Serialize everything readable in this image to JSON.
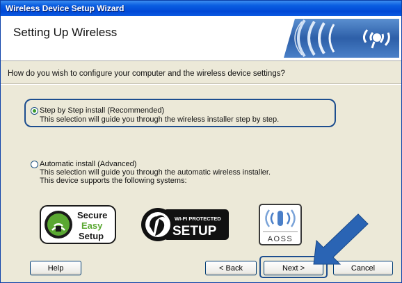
{
  "window": {
    "title": "Wireless Device Setup Wizard"
  },
  "header": {
    "title": "Setting Up Wireless",
    "banner_icon": "wireless-signal-icon"
  },
  "question": "How do you wish to configure your computer and the wireless device settings?",
  "options": [
    {
      "label": "Step by Step install (Recommended)",
      "description": "This selection will guide you through the wireless installer step by step.",
      "selected": true
    },
    {
      "label": "Automatic install (Advanced)",
      "description_lines": [
        "This selection will guide you through the automatic wireless installer.",
        "This device supports the following systems:"
      ],
      "selected": false
    }
  ],
  "logos": {
    "secure_easy_setup": {
      "line1": "Secure",
      "line2": "Easy",
      "line3": "Setup"
    },
    "wifi_protected_setup": {
      "top": "WI-FI PROTECTED",
      "bottom": "SETUP"
    },
    "aoss": {
      "text": "AOSS"
    }
  },
  "buttons": {
    "help": "Help",
    "back": "< Back",
    "next": "Next >",
    "cancel": "Cancel"
  },
  "colors": {
    "title_bar": "#0b5fe2",
    "highlight": "#1d4e8f",
    "radio_dot": "#3a9a2a",
    "arrow": "#2a64b4"
  }
}
